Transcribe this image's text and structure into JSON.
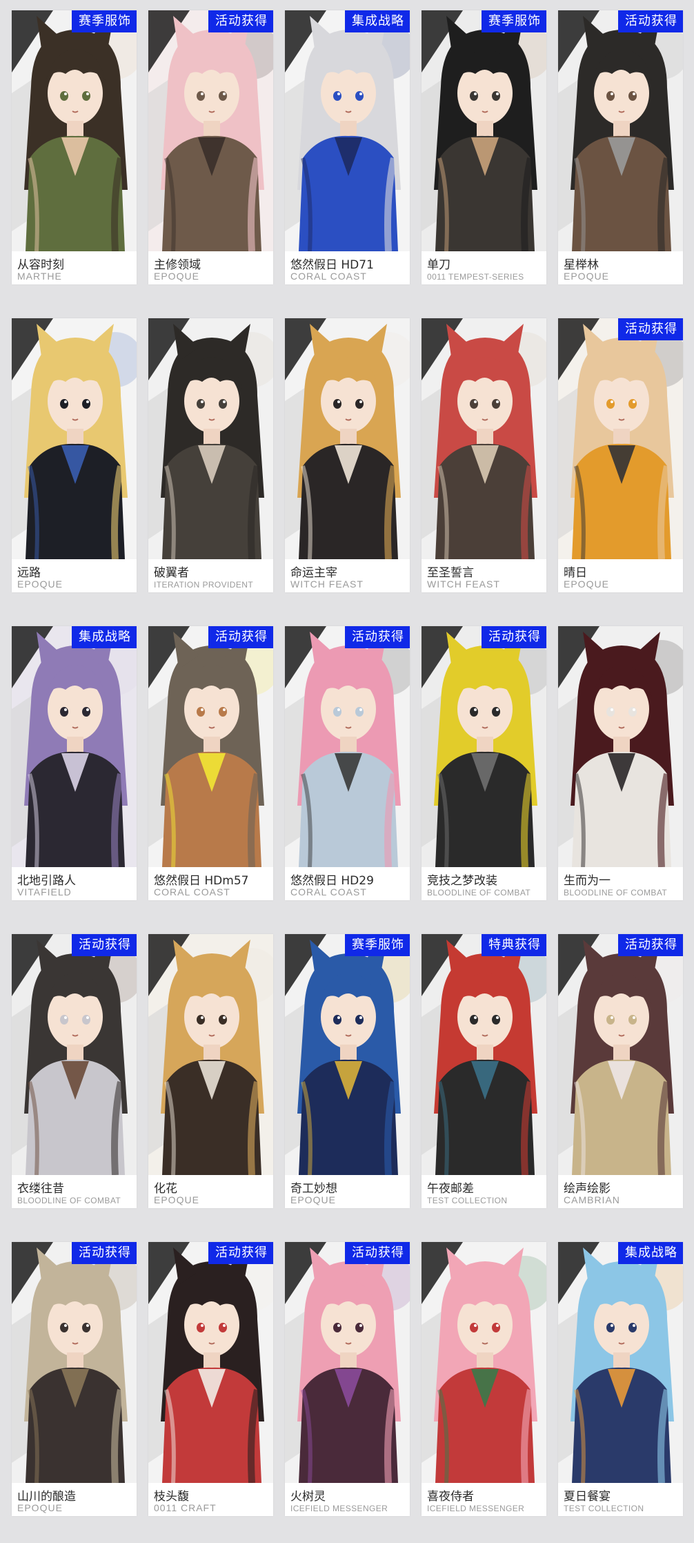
{
  "accent_color": "#1029e8",
  "cards": [
    {
      "name": "从容时刻",
      "series": "MARTHE",
      "badge": "赛季服饰",
      "palette": [
        "#f2f2f2",
        "#3b3026",
        "#5f6e3e",
        "#e9c6a8"
      ]
    },
    {
      "name": "主修领域",
      "series": "EPOQUE",
      "badge": "活动获得",
      "palette": [
        "#f4ecec",
        "#efc1c6",
        "#6e5a4a",
        "#3a2f2a"
      ]
    },
    {
      "name": "悠然假日 HD71",
      "series": "CORAL COAST",
      "badge": "集成战略",
      "palette": [
        "#f4f4f4",
        "#d8d8dc",
        "#2b4fc2",
        "#1d2a63"
      ]
    },
    {
      "name": "单刀",
      "series": "0011 TEMPEST-SERIES",
      "badge": "赛季服饰",
      "palette": [
        "#ececec",
        "#1e1e1e",
        "#3a3632",
        "#c9a27a"
      ]
    },
    {
      "name": "星榉林",
      "series": "EPOQUE",
      "badge": "活动获得",
      "palette": [
        "#efefef",
        "#2c2a28",
        "#6b5342",
        "#9a9a9a"
      ]
    },
    {
      "name": "远路",
      "series": "EPOQUE",
      "badge": "",
      "palette": [
        "#f4f4f4",
        "#e8c870",
        "#1d1f26",
        "#3a5db0"
      ]
    },
    {
      "name": "破翼者",
      "series": "ITERATION PROVIDENT",
      "badge": "",
      "palette": [
        "#f1f1f1",
        "#2d2a27",
        "#45403a",
        "#d7cbbd"
      ]
    },
    {
      "name": "命运主宰",
      "series": "WITCH FEAST",
      "badge": "",
      "palette": [
        "#f3f3f3",
        "#d9a552",
        "#2a2626",
        "#efe6d8"
      ]
    },
    {
      "name": "至圣誓言",
      "series": "WITCH FEAST",
      "badge": "",
      "palette": [
        "#f0f0f0",
        "#c94a45",
        "#4b3f38",
        "#d9c9b3"
      ]
    },
    {
      "name": "晴日",
      "series": "EPOQUE",
      "badge": "活动获得",
      "palette": [
        "#f4f1ec",
        "#e8c79c",
        "#e39b2c",
        "#333335"
      ]
    },
    {
      "name": "北地引路人",
      "series": "VITAFIELD",
      "badge": "集成战略",
      "palette": [
        "#e9e6ee",
        "#8f7bb6",
        "#2b2832",
        "#d9d2e6"
      ]
    },
    {
      "name": "悠然假日 HDm57",
      "series": "CORAL COAST",
      "badge": "活动获得",
      "palette": [
        "#f3f3f3",
        "#6e6356",
        "#b87a4a",
        "#f2e634"
      ]
    },
    {
      "name": "悠然假日 HD29",
      "series": "CORAL COAST",
      "badge": "活动获得",
      "palette": [
        "#f3f3f3",
        "#ec9ab3",
        "#b9c9d8",
        "#3a3a3a"
      ]
    },
    {
      "name": "竞技之梦改装",
      "series": "BLOODLINE OF COMBAT",
      "badge": "活动获得",
      "palette": [
        "#ededed",
        "#e2cc2a",
        "#2a2a2a",
        "#6f6f6f"
      ]
    },
    {
      "name": "生而为一",
      "series": "BLOODLINE OF COMBAT",
      "badge": "",
      "palette": [
        "#f0f0f0",
        "#4a1a1e",
        "#e8e4df",
        "#2a2628"
      ]
    },
    {
      "name": "衣缕往昔",
      "series": "BLOODLINE OF COMBAT",
      "badge": "活动获得",
      "palette": [
        "#eeeeee",
        "#3a3634",
        "#c8c6cc",
        "#6a4a3a"
      ]
    },
    {
      "name": "化花",
      "series": "EPOQUE",
      "badge": "",
      "palette": [
        "#f3f0ea",
        "#d6a65a",
        "#3a2e26",
        "#e9e1d6"
      ]
    },
    {
      "name": "奇工妙想",
      "series": "EPOQUE",
      "badge": "赛季服饰",
      "palette": [
        "#f2f2f2",
        "#2a5aa8",
        "#1d2c5a",
        "#d9b03a"
      ]
    },
    {
      "name": "午夜邮差",
      "series": "TEST COLLECTION",
      "badge": "特典获得",
      "palette": [
        "#eeeeee",
        "#c53a32",
        "#2a2a2a",
        "#3a6f86"
      ]
    },
    {
      "name": "绘声绘影",
      "series": "CAMBRIAN",
      "badge": "活动获得",
      "palette": [
        "#efefef",
        "#5a3a3a",
        "#c8b48a",
        "#ede6e6"
      ]
    },
    {
      "name": "山川的酿造",
      "series": "EPOQUE",
      "badge": "活动获得",
      "palette": [
        "#f1f1f1",
        "#c2b49a",
        "#3a3230",
        "#8a7658"
      ]
    },
    {
      "name": "枝头馥",
      "series": "0011 CRAFT",
      "badge": "活动获得",
      "palette": [
        "#f3f3f3",
        "#2a2020",
        "#c23a3a",
        "#f2ece6"
      ]
    },
    {
      "name": "火树灵",
      "series": "ICEFIELD MESSENGER",
      "badge": "活动获得",
      "palette": [
        "#f2f2f2",
        "#ee9fb3",
        "#4a2a3a",
        "#8a4a9a"
      ]
    },
    {
      "name": "喜夜侍者",
      "series": "ICEFIELD MESSENGER",
      "badge": "",
      "palette": [
        "#f3f3f3",
        "#f2a6b6",
        "#c23a3a",
        "#3a7a4a"
      ]
    },
    {
      "name": "夏日餐宴",
      "series": "TEST COLLECTION",
      "badge": "集成战略",
      "palette": [
        "#f2f2f2",
        "#8cc6e6",
        "#2a3a6a",
        "#e89a3a"
      ]
    }
  ]
}
